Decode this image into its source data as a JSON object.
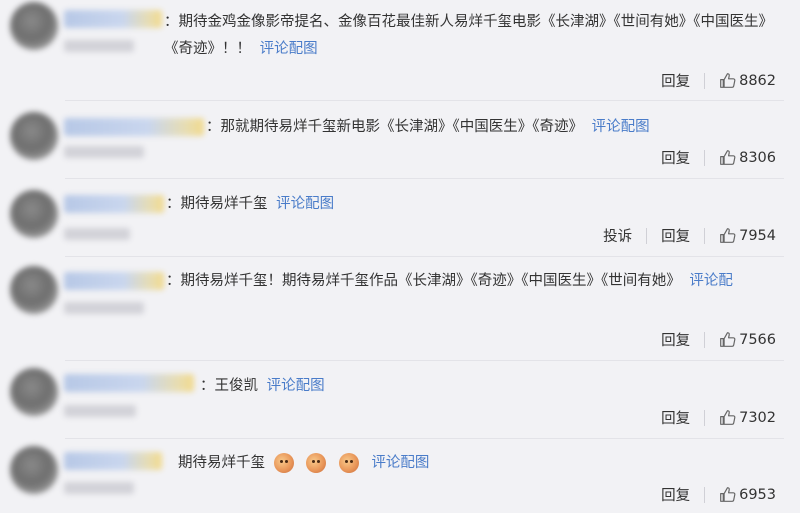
{
  "comments": [
    {
      "text": "：期待金鸡金像影帝提名、金像百花最佳新人易烊千玺电影《长津湖》《世间有她》《中国医生》《奇迹》！！",
      "link": "评论配图",
      "reply": "回复",
      "likes": "8862"
    },
    {
      "text": "：那就期待易烊千玺新电影《长津湖》《中国医生》《奇迹》",
      "link": "评论配图",
      "reply": "回复",
      "likes": "8306"
    },
    {
      "text": "：期待易烊千玺",
      "link": "评论配图",
      "report": "投诉",
      "reply": "回复",
      "likes": "7954"
    },
    {
      "text": "：期待易烊千玺！期待易烊千玺作品《长津湖》《奇迹》《中国医生》《世间有她》",
      "link": "评论配",
      "reply": "回复",
      "likes": "7566"
    },
    {
      "text": "：王俊凯",
      "link": "评论配图",
      "reply": "回复",
      "likes": "7302"
    },
    {
      "text": "期待易烊千玺",
      "emoji_count": "3",
      "emoji_icon": "face-emoji-icon",
      "link": "评论配图",
      "reply": "回复",
      "likes": "6953"
    }
  ],
  "colors": {
    "background": "#f2f2f5",
    "link": "#4a7cc9",
    "text": "#333333"
  },
  "icons": {
    "like": "thumbs-up-icon",
    "avatar": "blurred-avatar"
  }
}
